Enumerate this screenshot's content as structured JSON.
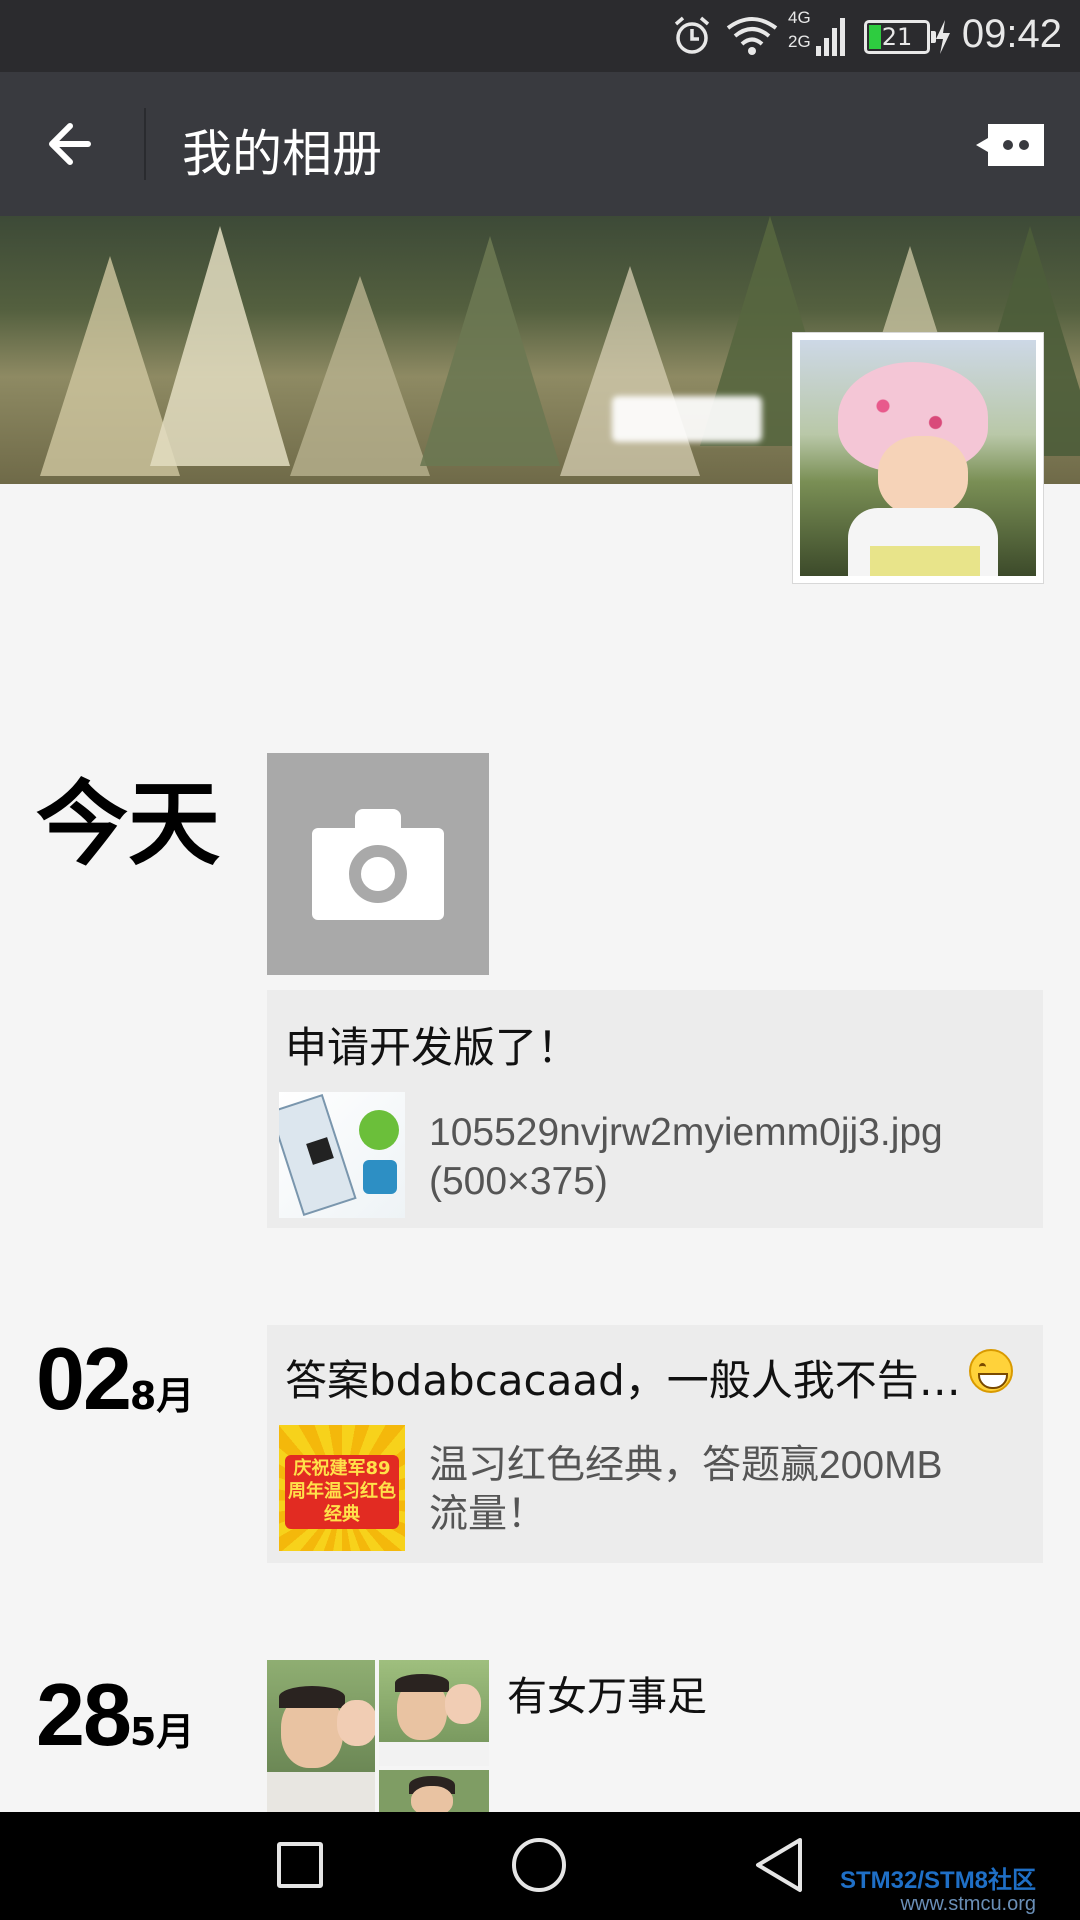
{
  "status_bar": {
    "time": "09:42",
    "battery": "21",
    "network_top": "4G",
    "network_bottom": "2G"
  },
  "header": {
    "title": "我的相册"
  },
  "timeline": {
    "today": {
      "label": "今天"
    },
    "entries": [
      {
        "day": "02",
        "month": "8月",
        "text": "答案bdabcacaad，一般人我不告…",
        "link_desc_line1": "温习红色经典，答题赢200MB",
        "link_desc_line2": "流量！",
        "thumb_text": "庆祝建军89周年温习红色经典"
      },
      {
        "day": "28",
        "month": "5月",
        "text": "有女万事足"
      }
    ],
    "today_post": {
      "text": "申请开发版了！",
      "file_name": "105529nvjrw2myiemm0jj3.jpg",
      "file_size": "(500×375)"
    }
  },
  "watermark": {
    "line1": "STM32/STM8社区",
    "line2": "www.stmcu.org"
  },
  "icons": {
    "back": "back-arrow-icon",
    "more": "more-icon",
    "camera": "camera-icon",
    "emoji": "grin-emoji-icon"
  }
}
